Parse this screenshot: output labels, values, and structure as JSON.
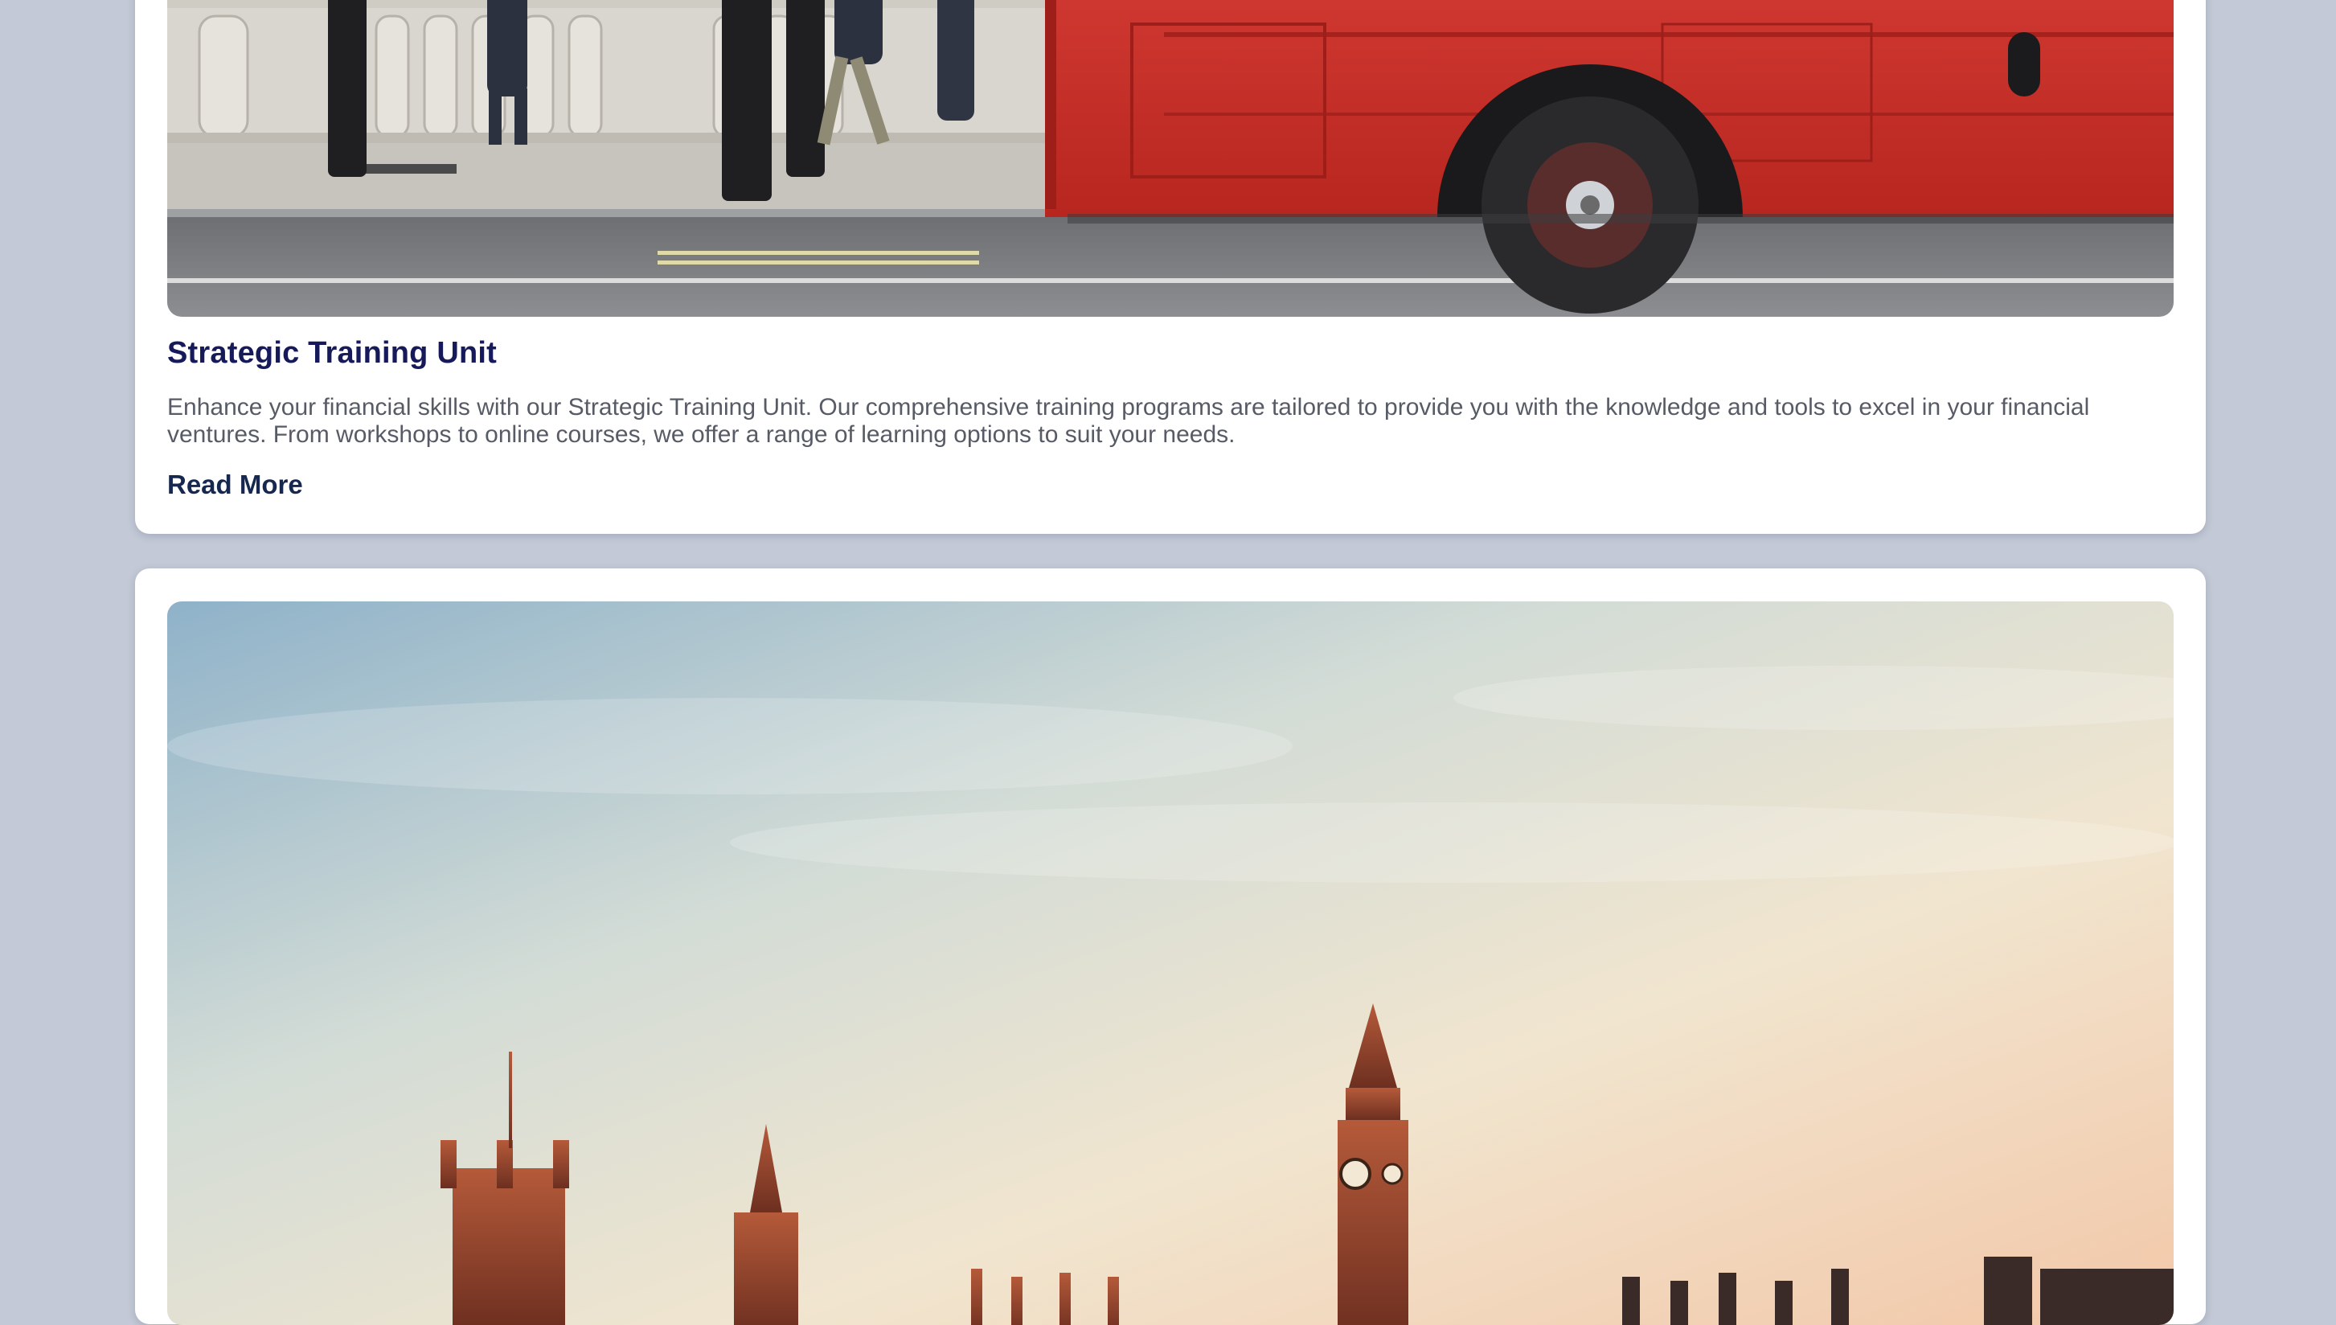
{
  "cards": [
    {
      "image_alt": "Red double-decker bus passing pedestrians on a London street",
      "title": "Strategic Training Unit",
      "description": "Enhance your financial skills with our Strategic Training Unit. Our comprehensive training programs are tailored to provide you with the knowledge and tools to excel in your financial ventures. From workshops to online courses, we offer a range of learning options to suit your needs.",
      "link_label": "Read More"
    },
    {
      "image_alt": "Houses of Parliament and Big Ben at sunset"
    }
  ],
  "colors": {
    "page_background": "#c3c9d6",
    "card_background": "#ffffff",
    "title": "#16195a",
    "link": "#16284f",
    "body_text": "#575b66",
    "bus_red": "#c8302c"
  }
}
